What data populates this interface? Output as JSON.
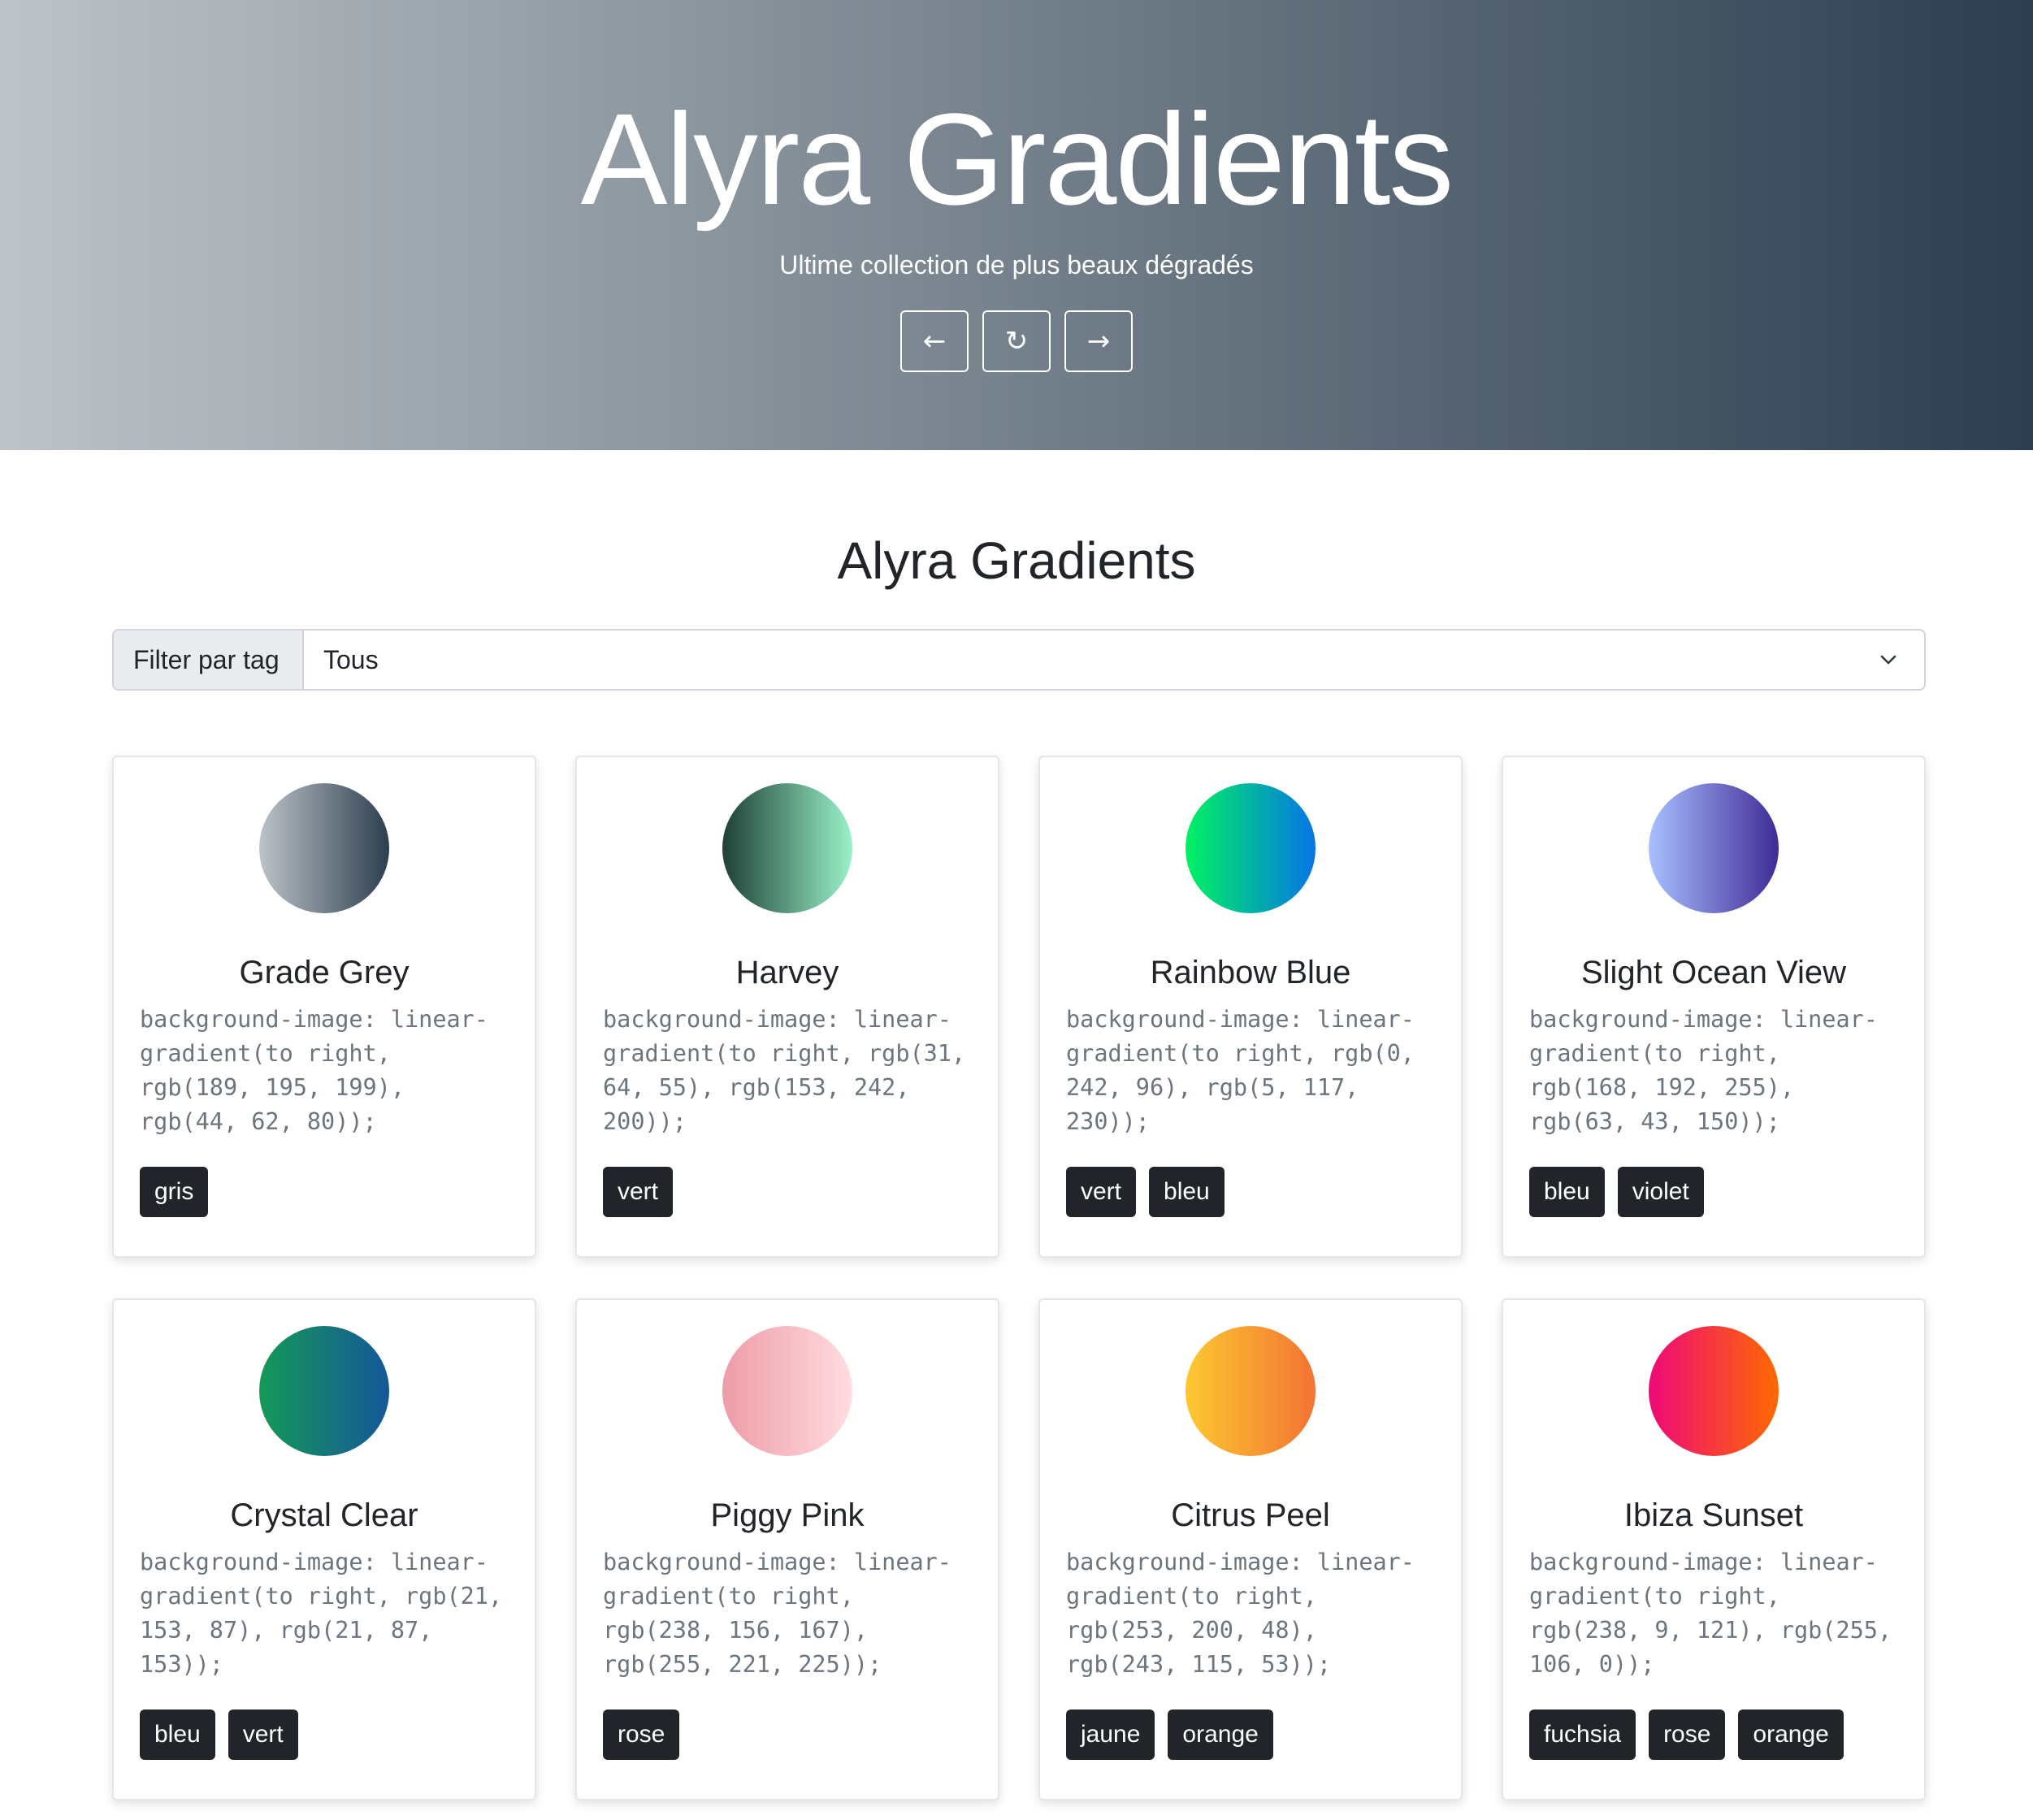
{
  "hero": {
    "title": "Alyra Gradients",
    "subtitle": "Ultime collection de plus beaux dégradés",
    "gradient_from": "#bdc3c7",
    "gradient_to": "#2c3e50",
    "controls": [
      {
        "icon": "arrow-left-icon",
        "glyph": "←"
      },
      {
        "icon": "refresh-icon",
        "glyph": "↻"
      },
      {
        "icon": "arrow-right-icon",
        "glyph": "→"
      }
    ]
  },
  "main": {
    "title": "Alyra Gradients",
    "filter": {
      "label": "Filter par tag",
      "selected": "Tous"
    }
  },
  "gradients": [
    {
      "name": "Grade Grey",
      "css": "background-image: linear-gradient(to right, rgb(189, 195, 199), rgb(44, 62, 80));",
      "start": "rgb(189, 195, 199)",
      "end": "rgb(44, 62, 80)",
      "tags": [
        "gris"
      ]
    },
    {
      "name": "Harvey",
      "css": "background-image: linear-gradient(to right, rgb(31, 64, 55), rgb(153, 242, 200));",
      "start": "rgb(31, 64, 55)",
      "end": "rgb(153, 242, 200)",
      "tags": [
        "vert"
      ]
    },
    {
      "name": "Rainbow Blue",
      "css": "background-image: linear-gradient(to right, rgb(0, 242, 96), rgb(5, 117, 230));",
      "start": "rgb(0, 242, 96)",
      "end": "rgb(5, 117, 230)",
      "tags": [
        "vert",
        "bleu"
      ]
    },
    {
      "name": "Slight Ocean View",
      "css": "background-image: linear-gradient(to right, rgb(168, 192, 255), rgb(63, 43, 150));",
      "start": "rgb(168, 192, 255)",
      "end": "rgb(63, 43, 150)",
      "tags": [
        "bleu",
        "violet"
      ]
    },
    {
      "name": "Crystal Clear",
      "css": "background-image: linear-gradient(to right, rgb(21, 153, 87), rgb(21, 87, 153));",
      "start": "rgb(21, 153, 87)",
      "end": "rgb(21, 87, 153)",
      "tags": [
        "bleu",
        "vert"
      ]
    },
    {
      "name": "Piggy Pink",
      "css": "background-image: linear-gradient(to right, rgb(238, 156, 167), rgb(255, 221, 225));",
      "start": "rgb(238, 156, 167)",
      "end": "rgb(255, 221, 225)",
      "tags": [
        "rose"
      ]
    },
    {
      "name": "Citrus Peel",
      "css": "background-image: linear-gradient(to right, rgb(253, 200, 48), rgb(243, 115, 53));",
      "start": "rgb(253, 200, 48)",
      "end": "rgb(243, 115, 53)",
      "tags": [
        "jaune",
        "orange"
      ]
    },
    {
      "name": "Ibiza Sunset",
      "css": "background-image: linear-gradient(to right, rgb(238, 9, 121), rgb(255, 106, 0));",
      "start": "rgb(238, 9, 121)",
      "end": "rgb(255, 106, 0)",
      "tags": [
        "fuchsia",
        "rose",
        "orange"
      ]
    }
  ]
}
